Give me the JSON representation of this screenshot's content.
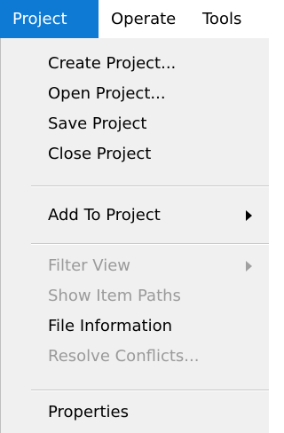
{
  "menubar": {
    "items": [
      {
        "label": "Project",
        "active": true
      },
      {
        "label": "Operate",
        "active": false
      },
      {
        "label": "Tools",
        "active": false
      }
    ]
  },
  "menu": {
    "items": [
      {
        "label": "Create Project...",
        "enabled": true
      },
      {
        "label": "Open Project...",
        "enabled": true
      },
      {
        "label": "Save Project",
        "enabled": true
      },
      {
        "label": "Close Project",
        "enabled": true
      },
      {
        "label": "Add To Project",
        "enabled": true,
        "submenu": true
      },
      {
        "label": "Filter View",
        "enabled": false,
        "submenu": true
      },
      {
        "label": "Show Item Paths",
        "enabled": false
      },
      {
        "label": "File Information",
        "enabled": true
      },
      {
        "label": "Resolve Conflicts...",
        "enabled": false
      },
      {
        "label": "Properties",
        "enabled": true
      }
    ]
  },
  "colors": {
    "active_highlight": "#0e7ad3",
    "menu_background": "#f0f0f0",
    "disabled_text": "#9a9a9a"
  }
}
